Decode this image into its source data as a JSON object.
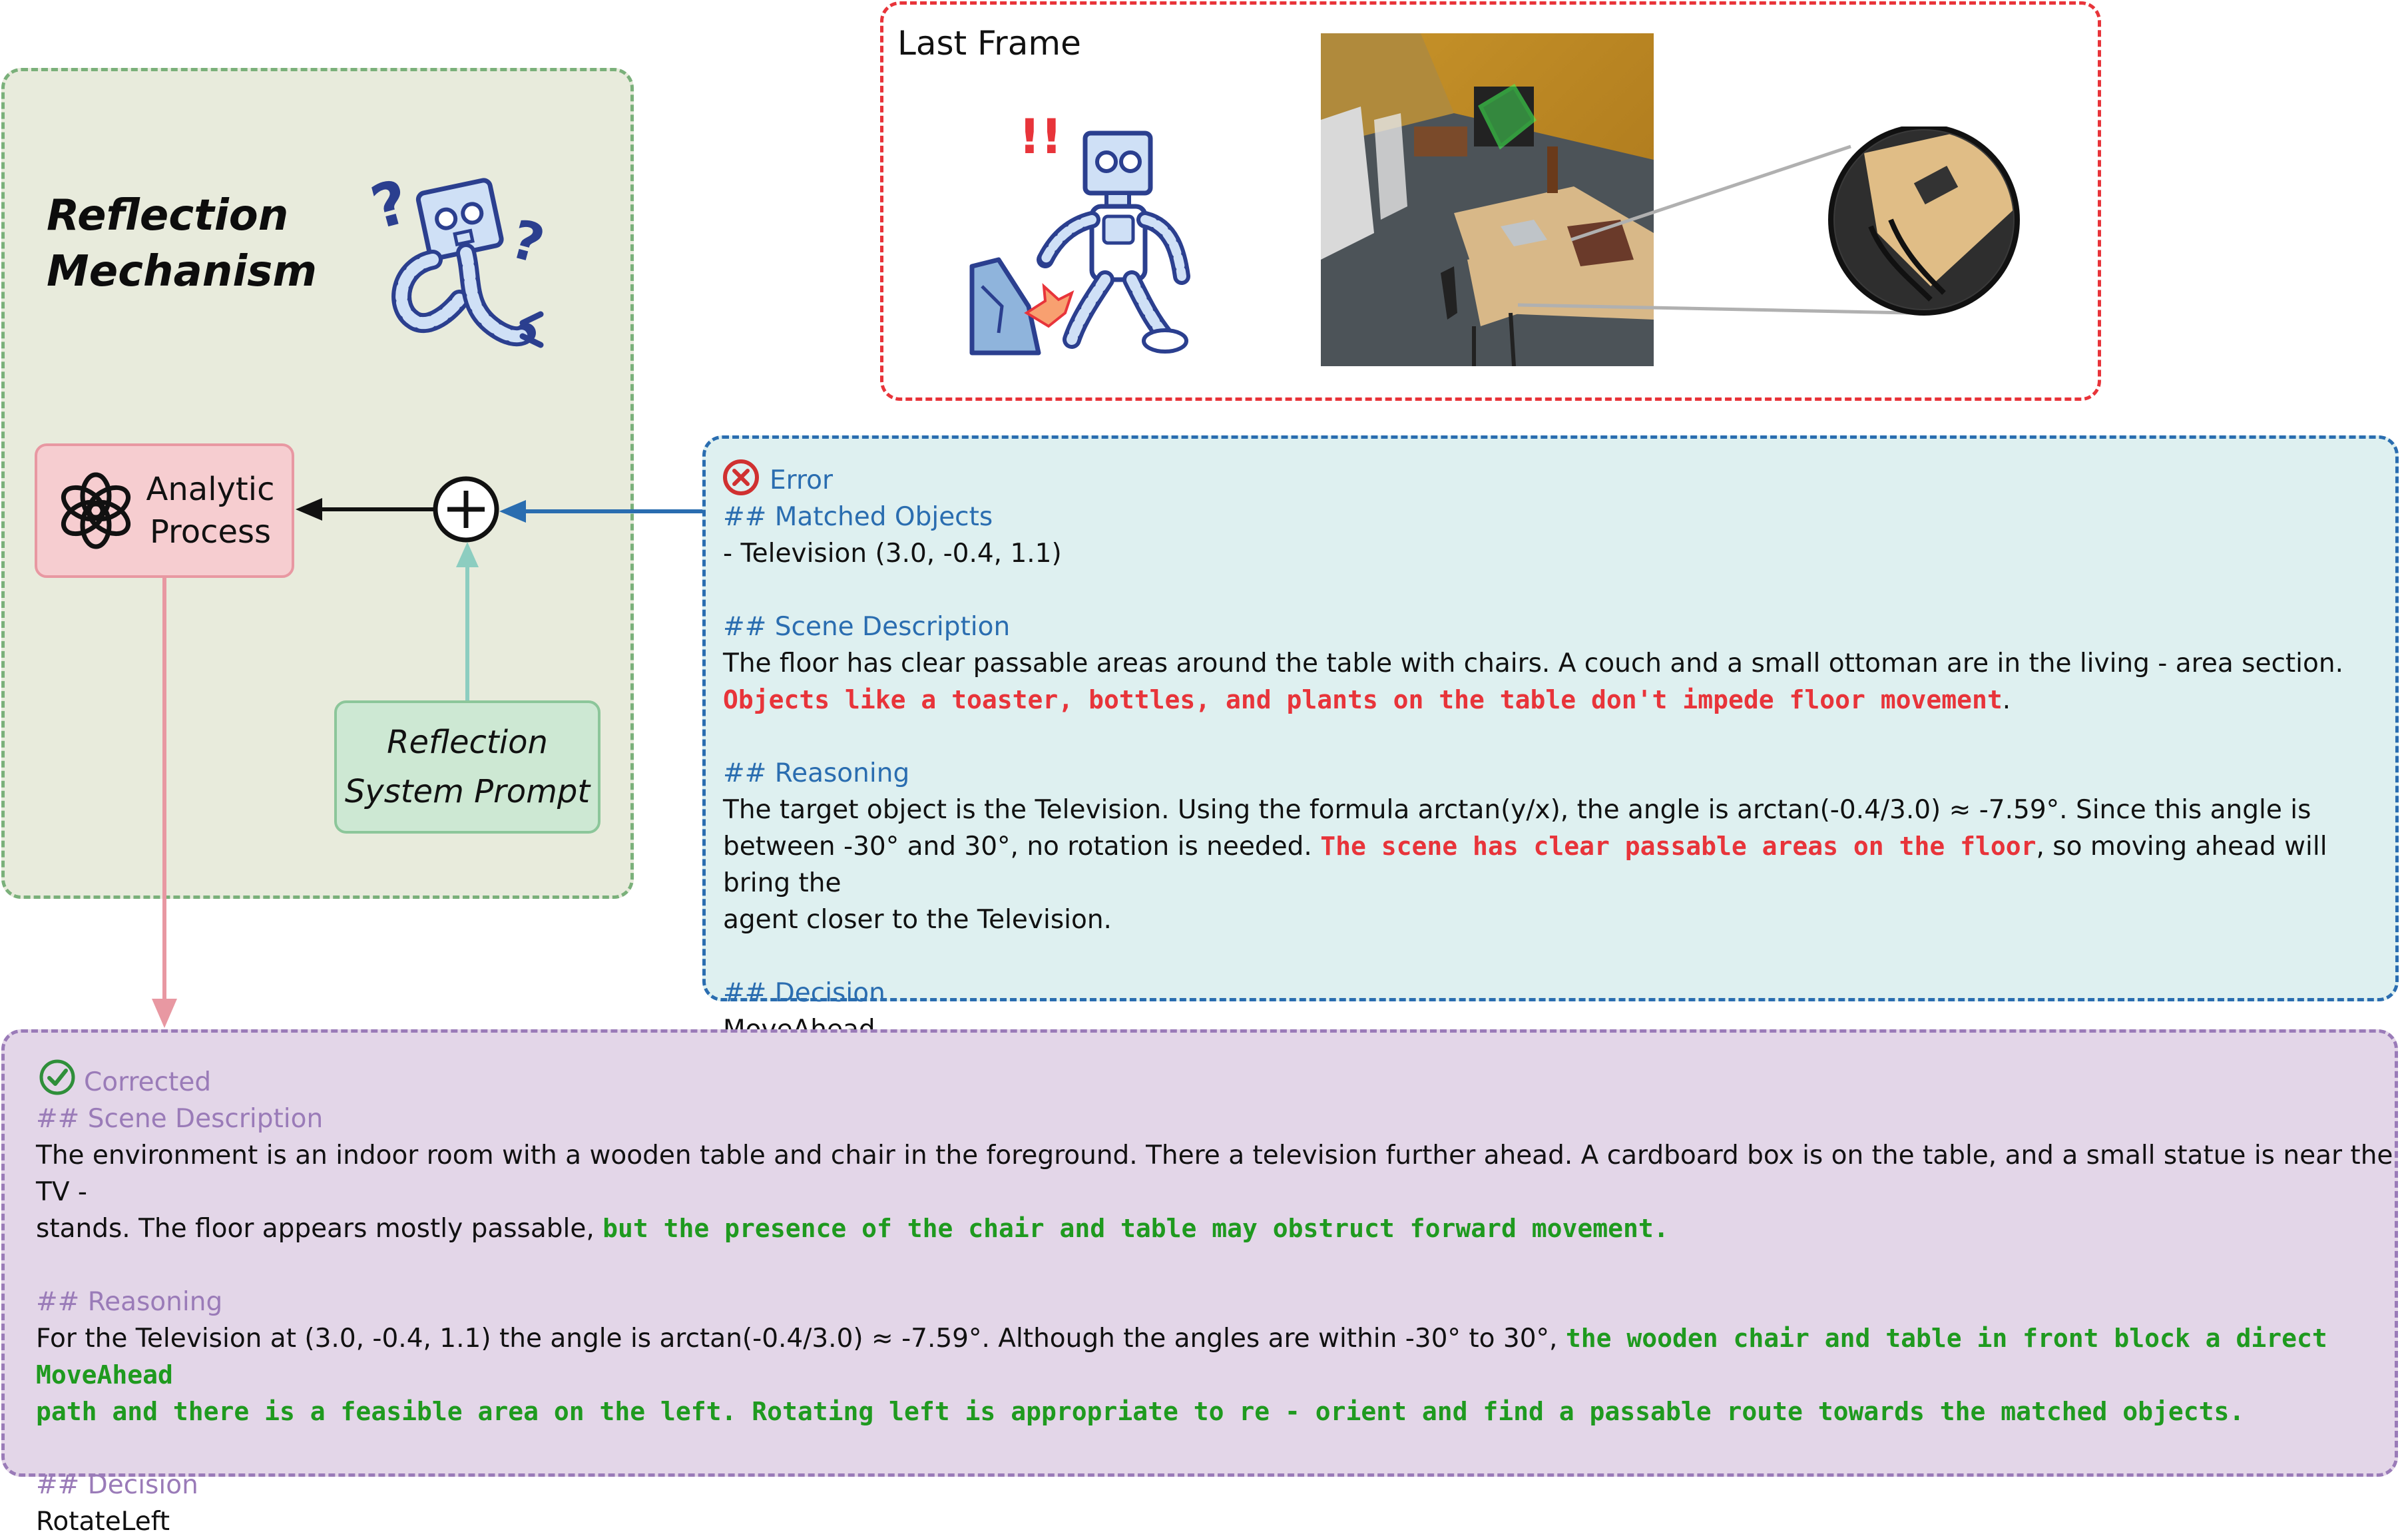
{
  "reflection": {
    "title_line1": "Reflection",
    "title_line2": "Mechanism",
    "analytic_line1": "Analytic",
    "analytic_line2": "Process",
    "prompt_line1": "Reflection",
    "prompt_line2": "System Prompt"
  },
  "last_frame": {
    "label": "Last Frame",
    "alert_text": "!!"
  },
  "error": {
    "status": "Error",
    "matched_header": "## Matched Objects",
    "matched_item": "- Television (3.0, -0.4, 1.1)",
    "scene_header": "## Scene Description",
    "scene_text": "The floor has clear passable areas around the table with chairs. A couch and a small ottoman are in the living - area section.",
    "scene_highlight": "Objects like a toaster, bottles, and plants on the table don't impede floor movement",
    "scene_tail": ".",
    "reasoning_header": "## Reasoning",
    "reasoning_line1": "The target object is the Television. Using the formula arctan(y/x), the angle is arctan(-0.4/3.0) ≈ -7.59°. Since this angle is",
    "reasoning_line2_a": "between -30° and 30°, no rotation is needed. ",
    "reasoning_line2_highlight": "The scene has clear passable areas on the floor",
    "reasoning_line2_b": ", so moving ahead will bring the",
    "reasoning_line3": "agent closer to the Television.",
    "decision_header": "## Decision",
    "decision_value": "MoveAhead"
  },
  "corrected": {
    "status": "Corrected",
    "scene_header": "## Scene Description",
    "scene_line1": "The environment is an indoor room with a wooden table and chair in the foreground. There a television further ahead. A cardboard box is on the table, and a small statue is near the TV -",
    "scene_line2_a": "stands. The floor appears mostly passable, ",
    "scene_line2_highlight": "but the presence of the chair and table may obstruct forward movement.",
    "reasoning_header": "## Reasoning",
    "reasoning_line1_a": "For the Television at (3.0, -0.4, 1.1) the angle is arctan(-0.4/3.0) ≈ -7.59°. Although the angles are within -30° to 30°, ",
    "reasoning_line1_highlight": "the wooden chair and table in front block a direct MoveAhead",
    "reasoning_line2_highlight": "path and there is a feasible area on the left. Rotating left is appropriate to re - orient and find a passable route towards the matched objects.",
    "decision_header": "## Decision",
    "decision_value": "RotateLeft"
  },
  "colors": {
    "error_blue": "#2a6db0",
    "error_red": "#e8343a",
    "corrected_green": "#1f9a1f",
    "corrected_purple": "#9a7bb8",
    "analytic_pink": "#f6cdd0",
    "prompt_green": "#cde8d3"
  },
  "icons": [
    "openai-icon",
    "error-x-icon",
    "check-icon",
    "confused-robot-icon",
    "fallen-robot-icon",
    "plus-circle-icon"
  ]
}
